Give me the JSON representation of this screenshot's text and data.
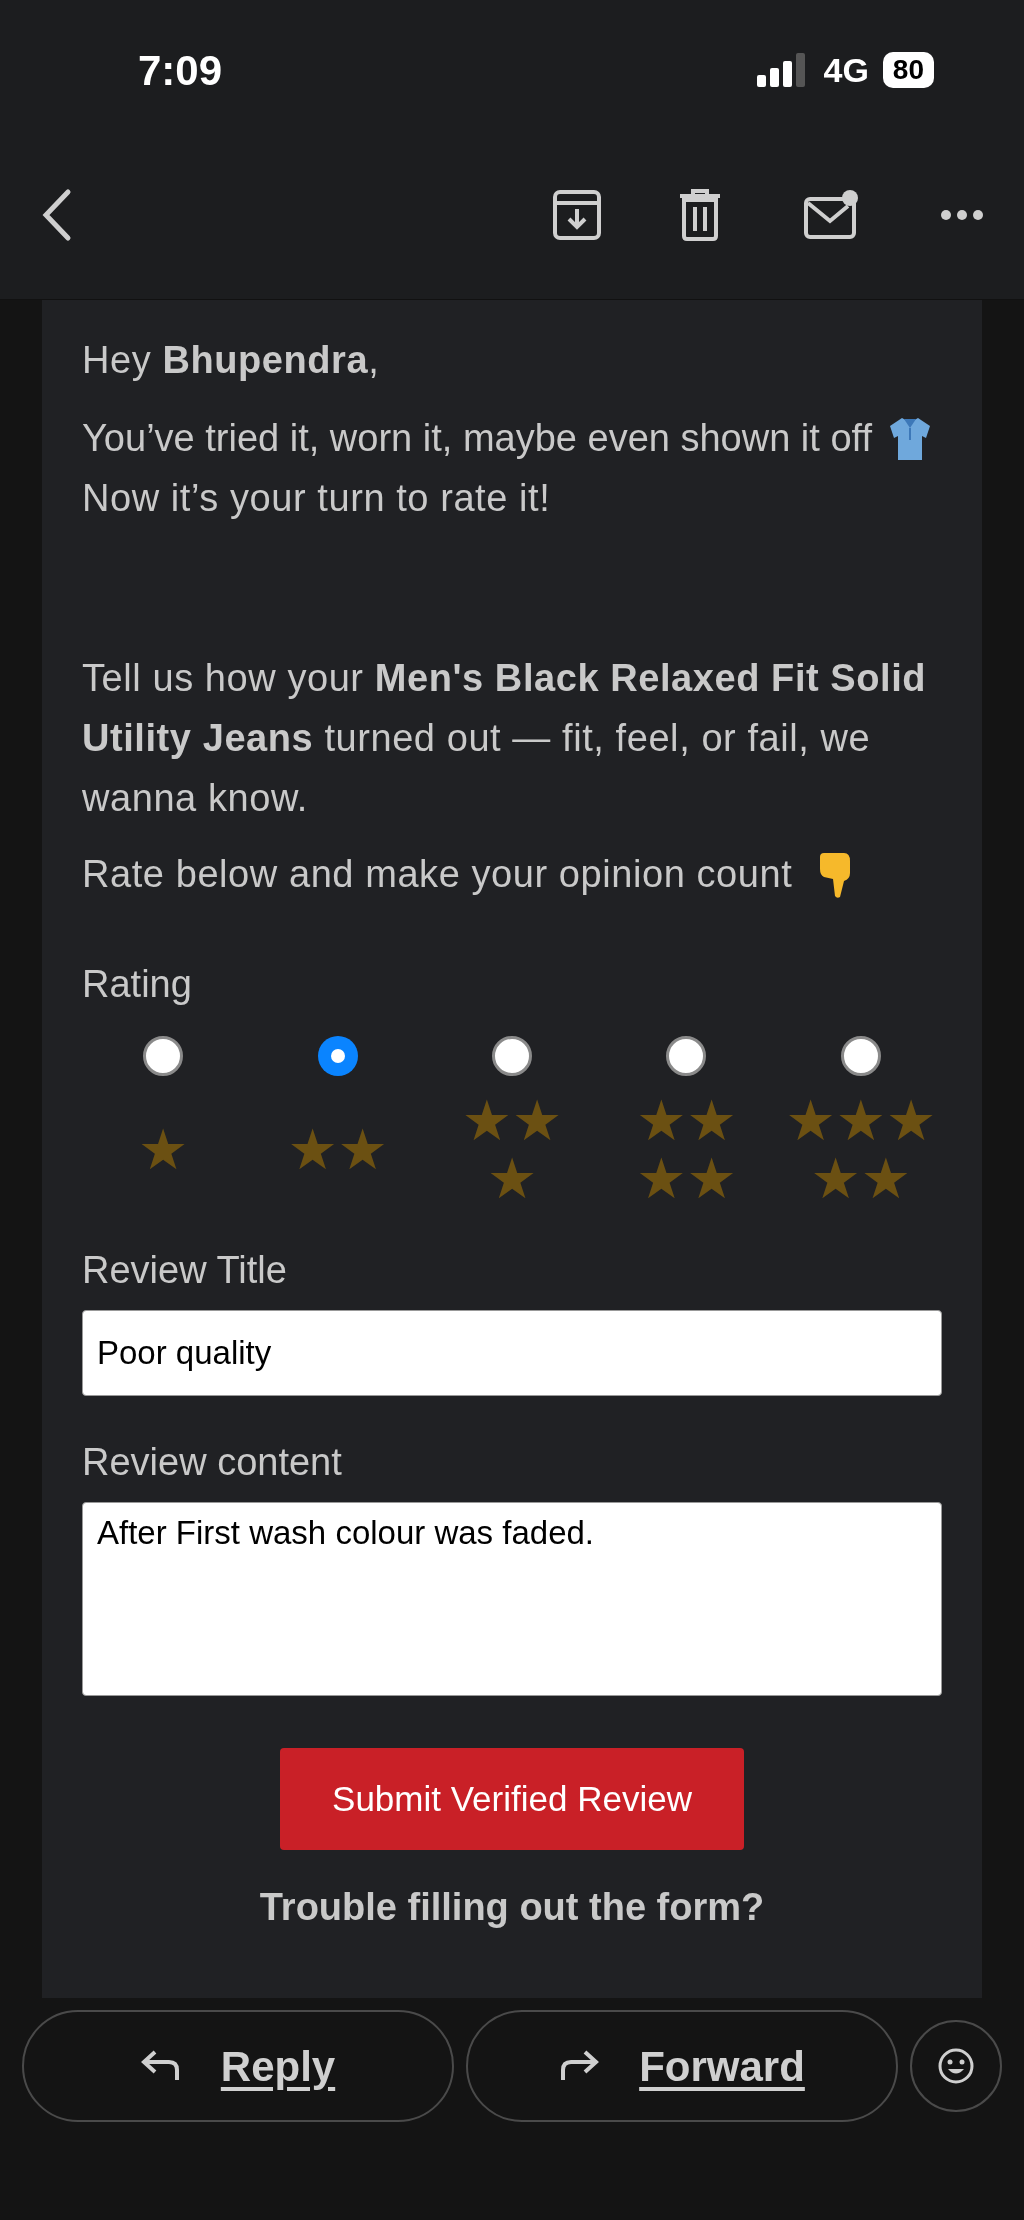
{
  "status_bar": {
    "time": "7:09",
    "network": "4G",
    "battery": "80"
  },
  "email": {
    "greeting": "Hey **Bhupendra**,",
    "intro": {
      "line1": "You’ve tried it, worn it, maybe even shown it off",
      "line2": "Now it’s your turn to rate it!"
    },
    "body": "Tell us how your **Men's Black Relaxed Fit Solid Utility Jeans** turned out — fit, feel, or fail, we wanna know.",
    "prompt": "Rate below and make your opinion count",
    "rating": {
      "label": "Rating",
      "options": [
        {
          "label": "★",
          "selected": false
        },
        {
          "label": "★★",
          "selected": true
        },
        {
          "label": "★★★",
          "selected": false
        },
        {
          "label": "★★★★",
          "selected": false
        },
        {
          "label": "★★★★★",
          "selected": false
        }
      ]
    },
    "title_field": {
      "label": "Review Title",
      "value": "Poor quality"
    },
    "content_field": {
      "label": "Review content",
      "value": "After First wash colour was faded."
    },
    "submit": "Submit Verified Review",
    "help": "Trouble filling out the form?"
  },
  "actions": {
    "reply": "Reply",
    "forward": "Forward"
  }
}
